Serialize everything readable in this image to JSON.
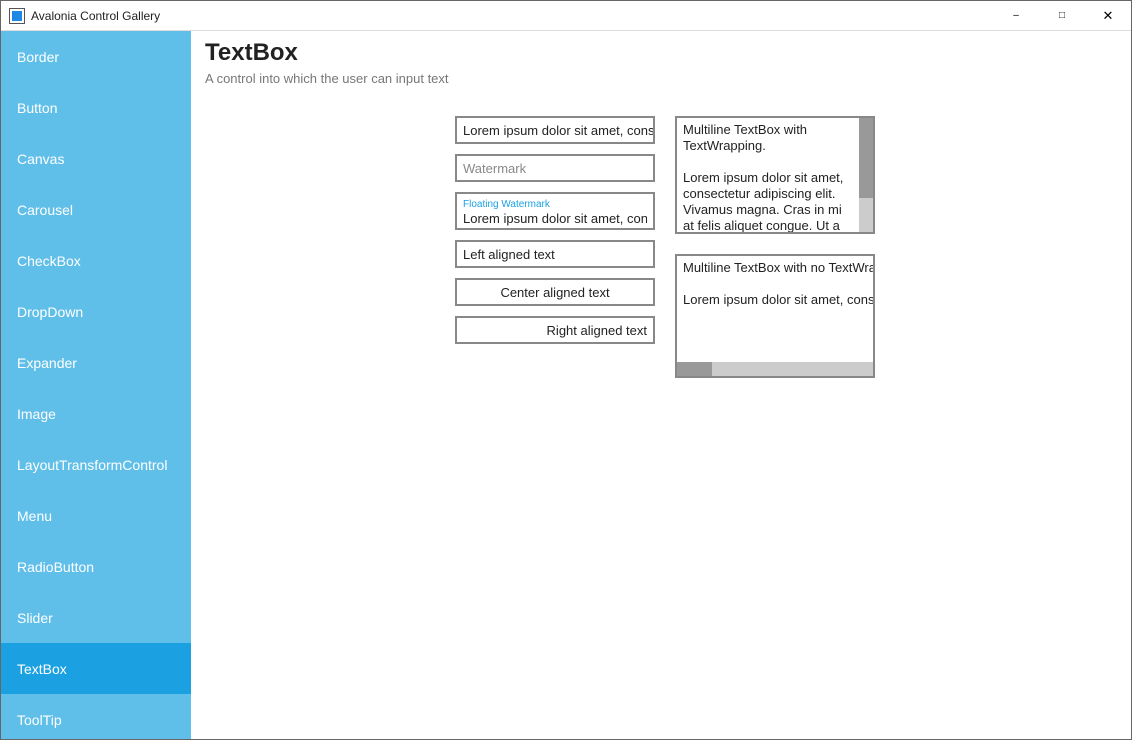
{
  "window": {
    "title": "Avalonia Control Gallery"
  },
  "sidebar": {
    "items": [
      {
        "label": "Border"
      },
      {
        "label": "Button"
      },
      {
        "label": "Canvas"
      },
      {
        "label": "Carousel"
      },
      {
        "label": "CheckBox"
      },
      {
        "label": "DropDown"
      },
      {
        "label": "Expander"
      },
      {
        "label": "Image"
      },
      {
        "label": "LayoutTransformControl"
      },
      {
        "label": "Menu"
      },
      {
        "label": "RadioButton"
      },
      {
        "label": "Slider"
      },
      {
        "label": "TextBox"
      },
      {
        "label": "ToolTip"
      }
    ],
    "selected_index": 12
  },
  "page": {
    "title": "TextBox",
    "subtitle": "A control into which the user can input text"
  },
  "demo": {
    "simple": "Lorem ipsum dolor sit amet, consec",
    "watermark_placeholder": "Watermark",
    "floating_label": "Floating Watermark",
    "floating_value": "Lorem ipsum dolor sit amet, consec",
    "left": "Left aligned text",
    "center": "Center aligned text",
    "right": "Right aligned text",
    "multiline_wrap_header": "Multiline TextBox with TextWrapping.",
    "multiline_wrap_body": "Lorem ipsum dolor sit amet, consectetur adipiscing elit. Vivamus magna. Cras in mi at felis aliquet congue. Ut a est eget",
    "multiline_nowrap_header": "Multiline TextBox with no TextWrapp",
    "multiline_nowrap_body": "Lorem ipsum dolor sit amet, consec"
  }
}
